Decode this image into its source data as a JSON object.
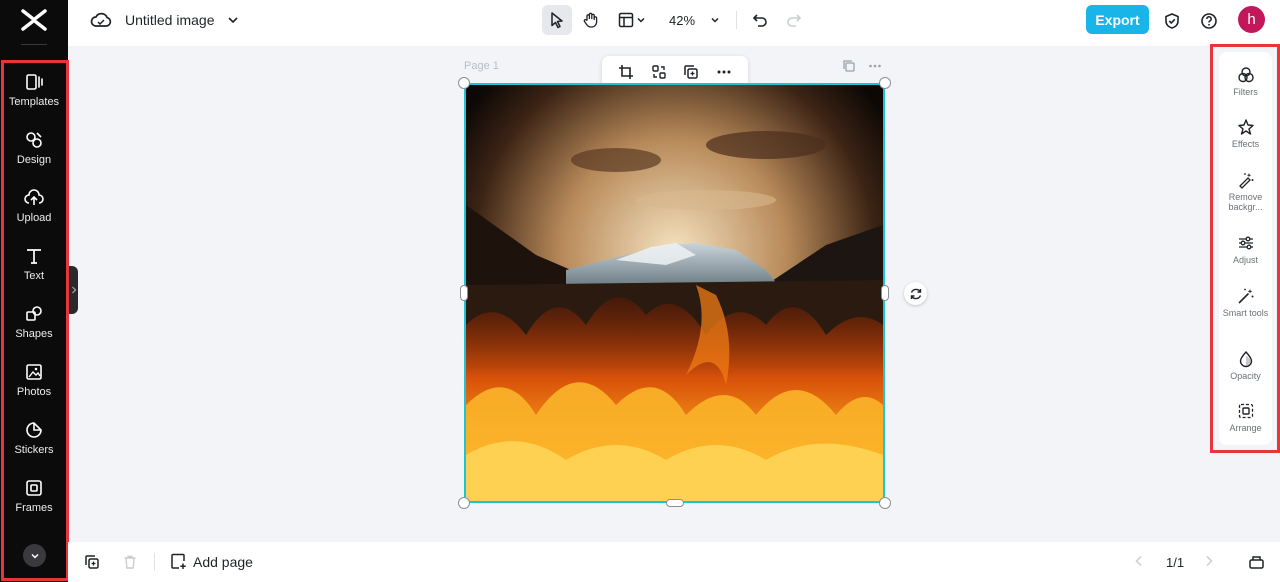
{
  "header": {
    "title": "Untitled image",
    "zoom": "42%",
    "export_label": "Export",
    "avatar_initial": "h"
  },
  "sidebar": {
    "items": [
      {
        "label": "Templates",
        "icon": "templates-icon"
      },
      {
        "label": "Design",
        "icon": "design-icon"
      },
      {
        "label": "Upload",
        "icon": "upload-icon"
      },
      {
        "label": "Text",
        "icon": "text-icon"
      },
      {
        "label": "Shapes",
        "icon": "shapes-icon"
      },
      {
        "label": "Photos",
        "icon": "photos-icon"
      },
      {
        "label": "Stickers",
        "icon": "stickers-icon"
      },
      {
        "label": "Frames",
        "icon": "frames-icon"
      }
    ]
  },
  "canvas": {
    "page_label": "Page 1"
  },
  "right_panel": {
    "items": [
      {
        "label": "Filters",
        "icon": "filters-icon"
      },
      {
        "label": "Effects",
        "icon": "effects-icon"
      },
      {
        "label": "Remove backgr...",
        "icon": "remove-background-icon"
      },
      {
        "label": "Adjust",
        "icon": "adjust-icon"
      },
      {
        "label": "Smart tools",
        "icon": "smart-tools-icon"
      },
      {
        "label": "Opacity",
        "icon": "opacity-icon"
      },
      {
        "label": "Arrange",
        "icon": "arrange-icon"
      }
    ]
  },
  "footer": {
    "add_page_label": "Add page",
    "page_count": "1/1"
  },
  "colors": {
    "accent": "#19b4e8",
    "selection": "#1fc3d4",
    "avatar": "#c2185b",
    "highlight_outline": "#e8343a"
  }
}
